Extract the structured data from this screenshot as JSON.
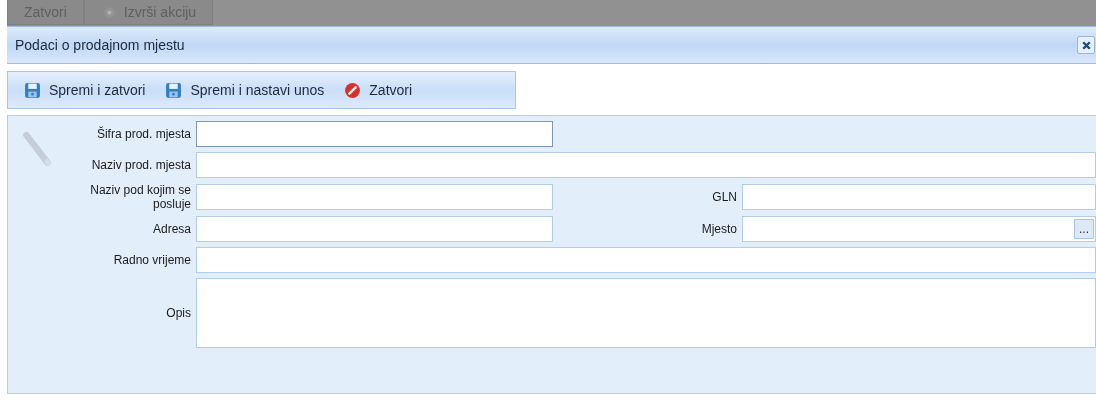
{
  "background_toolbar": {
    "buttons": [
      {
        "label": "Zatvori",
        "kind": "plain"
      },
      {
        "label": "Izvrši akciju",
        "kind": "action"
      }
    ]
  },
  "dialog": {
    "title": "Podaci o prodajnom mjestu",
    "toolbar": [
      {
        "label": "Spremi i zatvori",
        "kind": "save"
      },
      {
        "label": "Spremi i nastavi unos",
        "kind": "save"
      },
      {
        "label": "Zatvori",
        "kind": "cancel"
      }
    ],
    "form": {
      "rows": [
        {
          "fields": [
            {
              "label": "Šifra prod. mjesta",
              "kind": "short_text",
              "focused": true
            }
          ]
        },
        {
          "fields": [
            {
              "label": "Naziv prod. mjesta",
              "kind": "long_text",
              "focused": false
            }
          ]
        },
        {
          "fields": [
            {
              "label": "Naziv pod kojim se posluje",
              "kind": "short_text",
              "focused": false
            },
            {
              "label": "GLN",
              "kind": "short_text",
              "focused": false
            }
          ]
        },
        {
          "fields": [
            {
              "label": "Adresa",
              "kind": "short_text",
              "focused": false
            },
            {
              "label": "Mjesto",
              "kind": "lookup",
              "focused": false,
              "button": "..."
            }
          ]
        },
        {
          "fields": [
            {
              "label": "Radno vrijeme",
              "kind": "long_text",
              "focused": false
            }
          ]
        },
        {
          "fields": [
            {
              "label": "Opis",
              "kind": "textarea",
              "focused": false
            }
          ]
        }
      ]
    }
  }
}
